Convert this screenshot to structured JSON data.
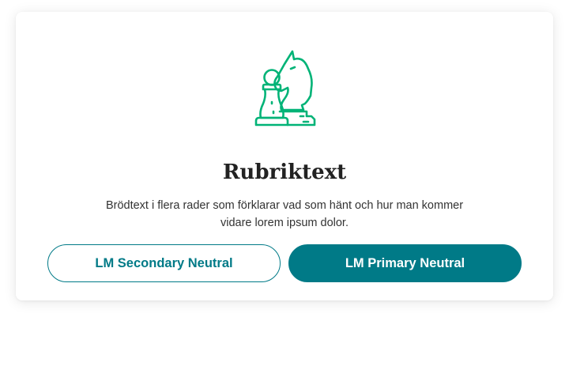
{
  "dialog": {
    "illustration_icon": "chess-knight-pawn-icon",
    "title": "Rubriktext",
    "body": "Brödtext i flera rader som förklarar vad som hänt och hur man kommer vidare lorem ipsum dolor.",
    "secondary_button_label": "LM Secondary Neutral",
    "primary_button_label": "LM Primary Neutral"
  },
  "colors": {
    "brand_teal": "#007a87",
    "illustration_green": "#00b377",
    "title_text": "#222222",
    "body_text": "#333333"
  }
}
